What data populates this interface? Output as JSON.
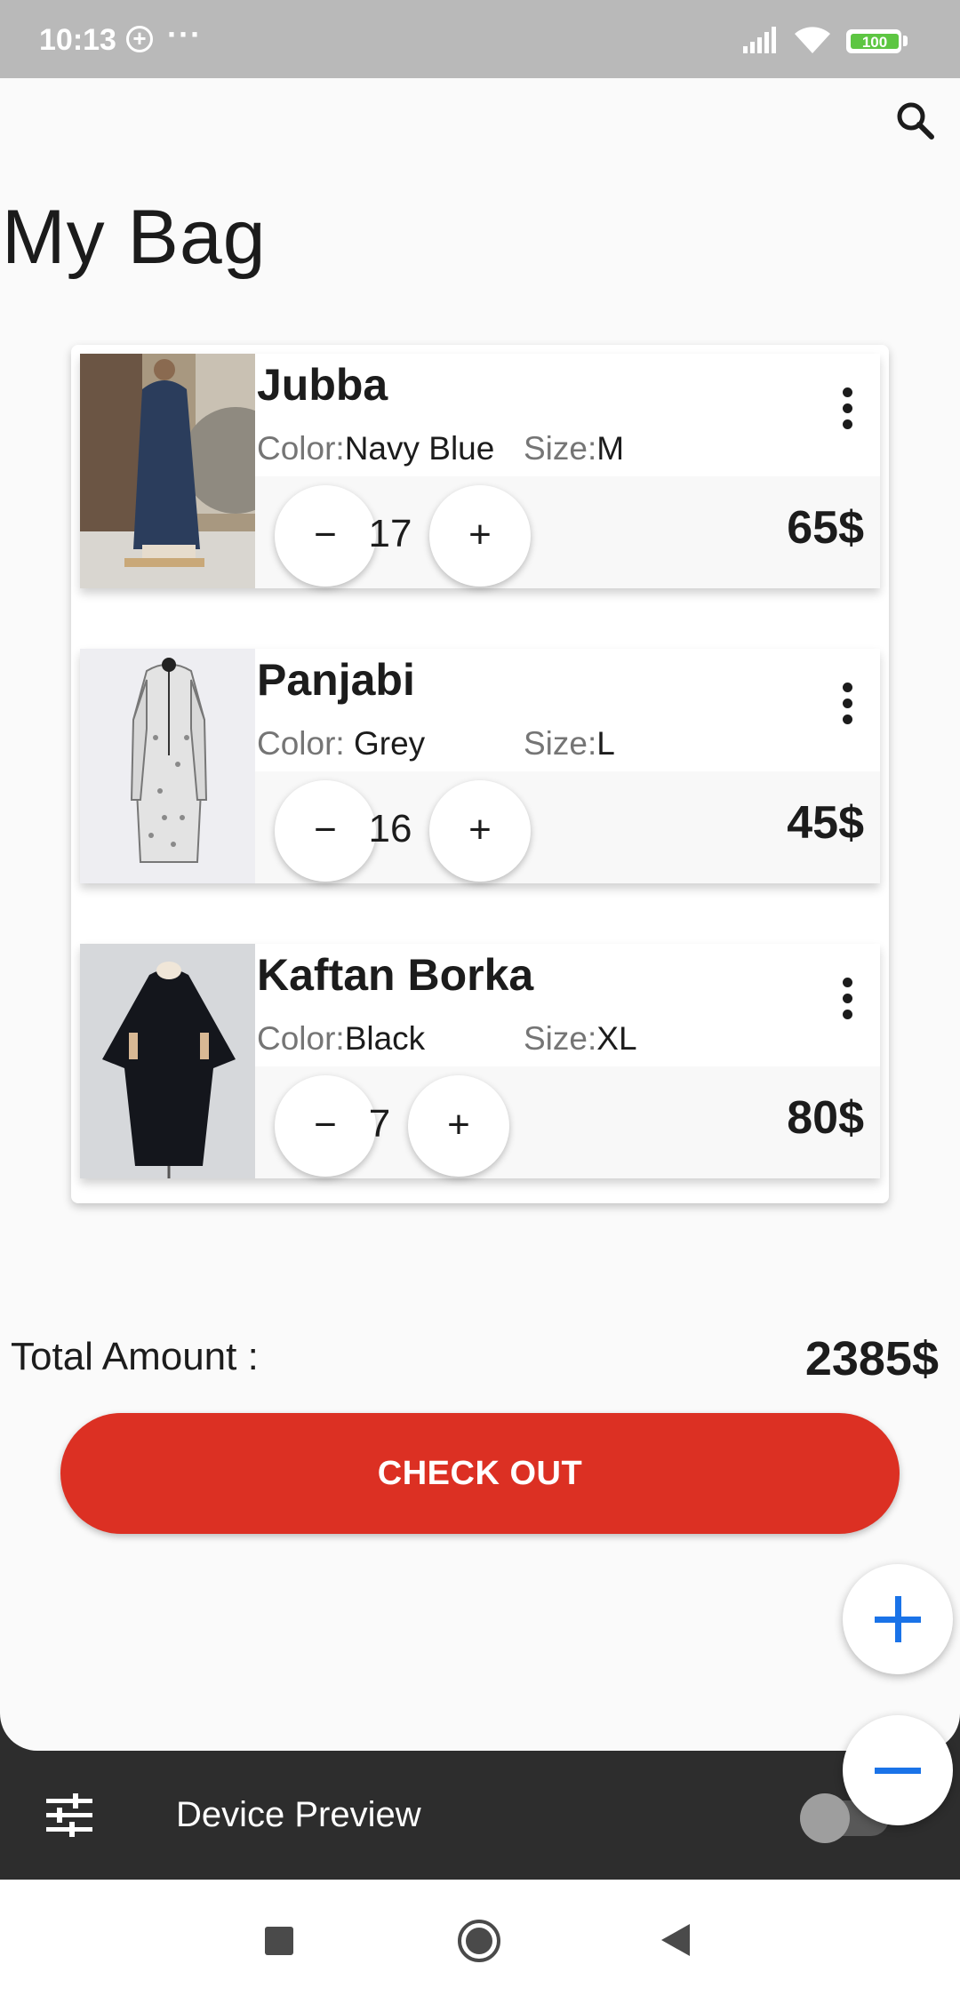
{
  "status_bar": {
    "time": "10:13",
    "plus_icon": "+",
    "dots": "···",
    "battery": "100"
  },
  "page": {
    "title": "My Bag"
  },
  "items": [
    {
      "name": "Jubba",
      "color_label": "Color:",
      "color_value": "Navy Blue",
      "size_label": "Size:",
      "size_value": "M",
      "quantity": "17",
      "price": "65$",
      "decrement_label": "−",
      "increment_label": "+",
      "image_icon": "robe-photo-navy"
    },
    {
      "name": "Panjabi",
      "color_label": "Color: ",
      "color_value": "Grey",
      "size_label": "Size:",
      "size_value": "L",
      "quantity": "16",
      "price": "45$",
      "decrement_label": "−",
      "increment_label": "+",
      "image_icon": "robe-photo-grey"
    },
    {
      "name": "Kaftan Borka",
      "color_label": "Color:",
      "color_value": "Black",
      "size_label": "Size:",
      "size_value": "XL",
      "quantity": "7",
      "price": "80$",
      "decrement_label": "−",
      "increment_label": "+",
      "image_icon": "robe-photo-black"
    }
  ],
  "summary": {
    "total_label": "Total Amount :",
    "total_value": "2385$",
    "checkout_label": "CHECK OUT"
  },
  "fab": {
    "plus_icon": "plus-icon",
    "minus_icon": "minus-icon",
    "accent": "#1a73e8"
  },
  "device_preview": {
    "label": "Device Preview",
    "toggle_on": false
  },
  "colors": {
    "checkout": "#dc3023",
    "status_bar": "#b9b9b9",
    "battery": "#5dc642"
  }
}
